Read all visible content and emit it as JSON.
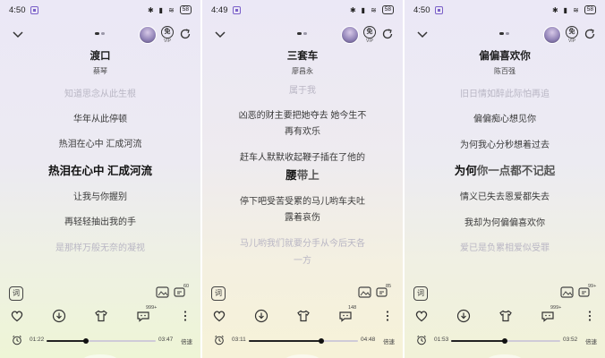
{
  "panels": [
    {
      "status": {
        "time": "4:50",
        "battery": "58"
      },
      "song": {
        "title": "渡口",
        "artist": "蔡琴"
      },
      "avatar_badge": "免",
      "avatar_badge_sub": "VIP",
      "lyrics": [
        {
          "text": "知道思念从此生根",
          "style": "faded"
        },
        {
          "text": "华年从此停顿",
          "style": "normal"
        },
        {
          "text": "热泪在心中 汇成河流",
          "style": "normal"
        },
        {
          "text": "热泪在心中 汇成河流",
          "style": "current"
        },
        {
          "text": "让我与你握别",
          "style": "normal"
        },
        {
          "text": "再轻轻抽出我的手",
          "style": "normal"
        },
        {
          "text": "是那样万般无奈的凝视",
          "style": "faded"
        }
      ],
      "poster_count": "",
      "comment_count": "60",
      "share_count": "",
      "fav_count": "999+",
      "playback": {
        "elapsed": "01:22",
        "total": "03:47",
        "speed_label": "倍速",
        "progress": 0.36
      }
    },
    {
      "status": {
        "time": "4:49",
        "battery": "58"
      },
      "song": {
        "title": "三套车",
        "artist": "廖昌永"
      },
      "avatar_badge": "免",
      "avatar_badge_sub": "VIP",
      "lyrics": [
        {
          "text": "属于我",
          "style": "faded"
        },
        {
          "text": "凶恶的财主要把她夺去 她今生不",
          "style": "normal"
        },
        {
          "text": "再有欢乐",
          "style": "normal"
        },
        {
          "text": "赶车人默默收起鞭子插在了他的",
          "style": "normal"
        },
        {
          "text_a": "腰",
          "text_b": "带上",
          "style": "progress"
        },
        {
          "text": "停下吧受苦受累的马儿哟车夫吐",
          "style": "normal"
        },
        {
          "text": "露着哀伤",
          "style": "normal"
        },
        {
          "text": "马儿哟我们就要分手从今后天各",
          "style": "faded"
        },
        {
          "text": "一方",
          "style": "faded"
        }
      ],
      "poster_count": "",
      "comment_count": "85",
      "share_count": "",
      "fav_count": "148",
      "playback": {
        "elapsed": "03:11",
        "total": "04:48",
        "speed_label": "倍速",
        "progress": 0.66
      }
    },
    {
      "status": {
        "time": "4:50",
        "battery": "58"
      },
      "song": {
        "title": "偏偏喜欢你",
        "artist": "陈百强"
      },
      "avatar_badge": "免",
      "avatar_badge_sub": "VIP",
      "lyrics": [
        {
          "text": "旧日情如醉此际怕再追",
          "style": "faded"
        },
        {
          "text": "偏偏痴心想见你",
          "style": "normal"
        },
        {
          "text": "为何我心分秒想着过去",
          "style": "normal"
        },
        {
          "text_a": "为何",
          "text_b": "你一点都不记起",
          "style": "progress"
        },
        {
          "text": "情义已失去恩爱都失去",
          "style": "normal"
        },
        {
          "text": "我却为何偏偏喜欢你",
          "style": "normal"
        },
        {
          "text": "爱已是负累相爱似受罪",
          "style": "faded"
        }
      ],
      "poster_count": "",
      "comment_count": "99+",
      "share_count": "",
      "fav_count": "999+",
      "playback": {
        "elapsed": "01:53",
        "total": "03:52",
        "speed_label": "倍速",
        "progress": 0.49
      }
    }
  ],
  "labels": {
    "lyrics_button": "词"
  },
  "colors": {
    "accent_purple": "#7a5fc8",
    "text_dark": "#1c1c1c",
    "faded": "#b9b6c4"
  }
}
